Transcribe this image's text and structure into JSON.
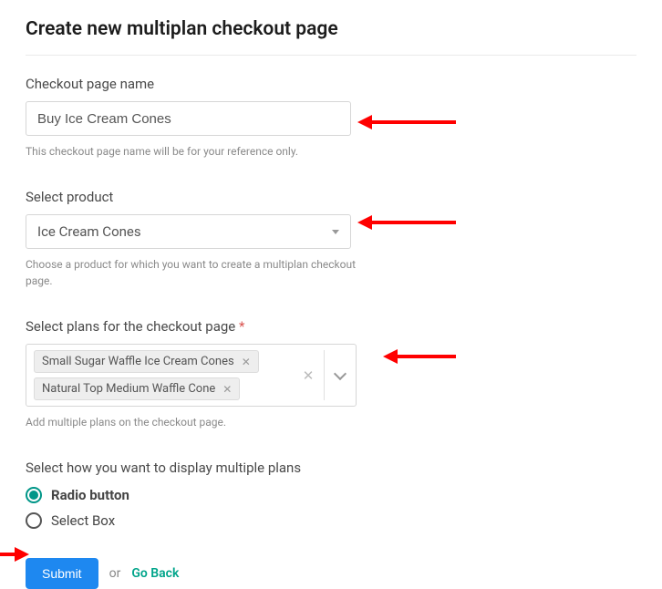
{
  "title": "Create new multiplan checkout page",
  "checkoutName": {
    "label": "Checkout page name",
    "value": "Buy Ice Cream Cones",
    "help": "This checkout page name will be for your reference only."
  },
  "product": {
    "label": "Select product",
    "selected": "Ice Cream Cones",
    "help": "Choose a product for which you want to create a multiplan checkout page."
  },
  "plans": {
    "label": "Select plans for the checkout page",
    "required": "*",
    "tags": [
      "Small Sugar Waffle Ice Cream Cones",
      "Natural Top Medium Waffle Cone"
    ],
    "help": "Add multiple plans on the checkout page."
  },
  "displayMode": {
    "label": "Select how you want to display multiple plans",
    "options": [
      {
        "label": "Radio button",
        "selected": true
      },
      {
        "label": "Select Box",
        "selected": false
      }
    ]
  },
  "actions": {
    "submit": "Submit",
    "or": "or",
    "goback": "Go Back"
  }
}
